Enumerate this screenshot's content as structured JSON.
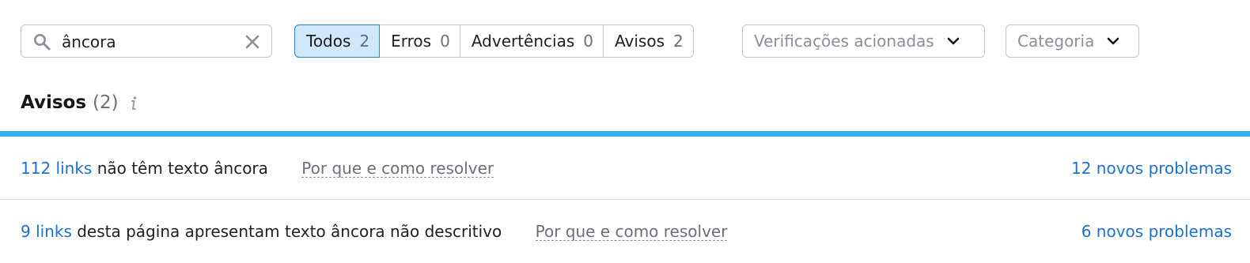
{
  "search": {
    "value": "âncora",
    "icon": "search-icon",
    "clear_icon": "close-icon"
  },
  "filters": [
    {
      "label": "Todos",
      "count": "2",
      "active": true
    },
    {
      "label": "Erros",
      "count": "0",
      "active": false
    },
    {
      "label": "Advertências",
      "count": "0",
      "active": false
    },
    {
      "label": "Avisos",
      "count": "2",
      "active": false
    }
  ],
  "dropdowns": {
    "checks": {
      "placeholder": "Verificações acionadas",
      "icon": "chevron-down-icon"
    },
    "category": {
      "placeholder": "Categoria",
      "icon": "chevron-down-icon"
    }
  },
  "section": {
    "title": "Avisos",
    "count": "(2)",
    "info_icon": "info-icon"
  },
  "issues": [
    {
      "link": "112 links",
      "text": "não têm texto âncora",
      "why": "Por que e como resolver",
      "new_issues": "12 novos problemas"
    },
    {
      "link": "9 links",
      "text": "desta página apresentam texto âncora não descritivo",
      "why": "Por que e como resolver",
      "new_issues": "6 novos problemas"
    }
  ],
  "colors": {
    "accent_link": "#1d6fd1",
    "active_filter_bg": "#cfe8fb",
    "active_filter_border": "#2b7fd4",
    "section_bar": "#2bb3f0",
    "muted_text": "#6c6e79"
  }
}
